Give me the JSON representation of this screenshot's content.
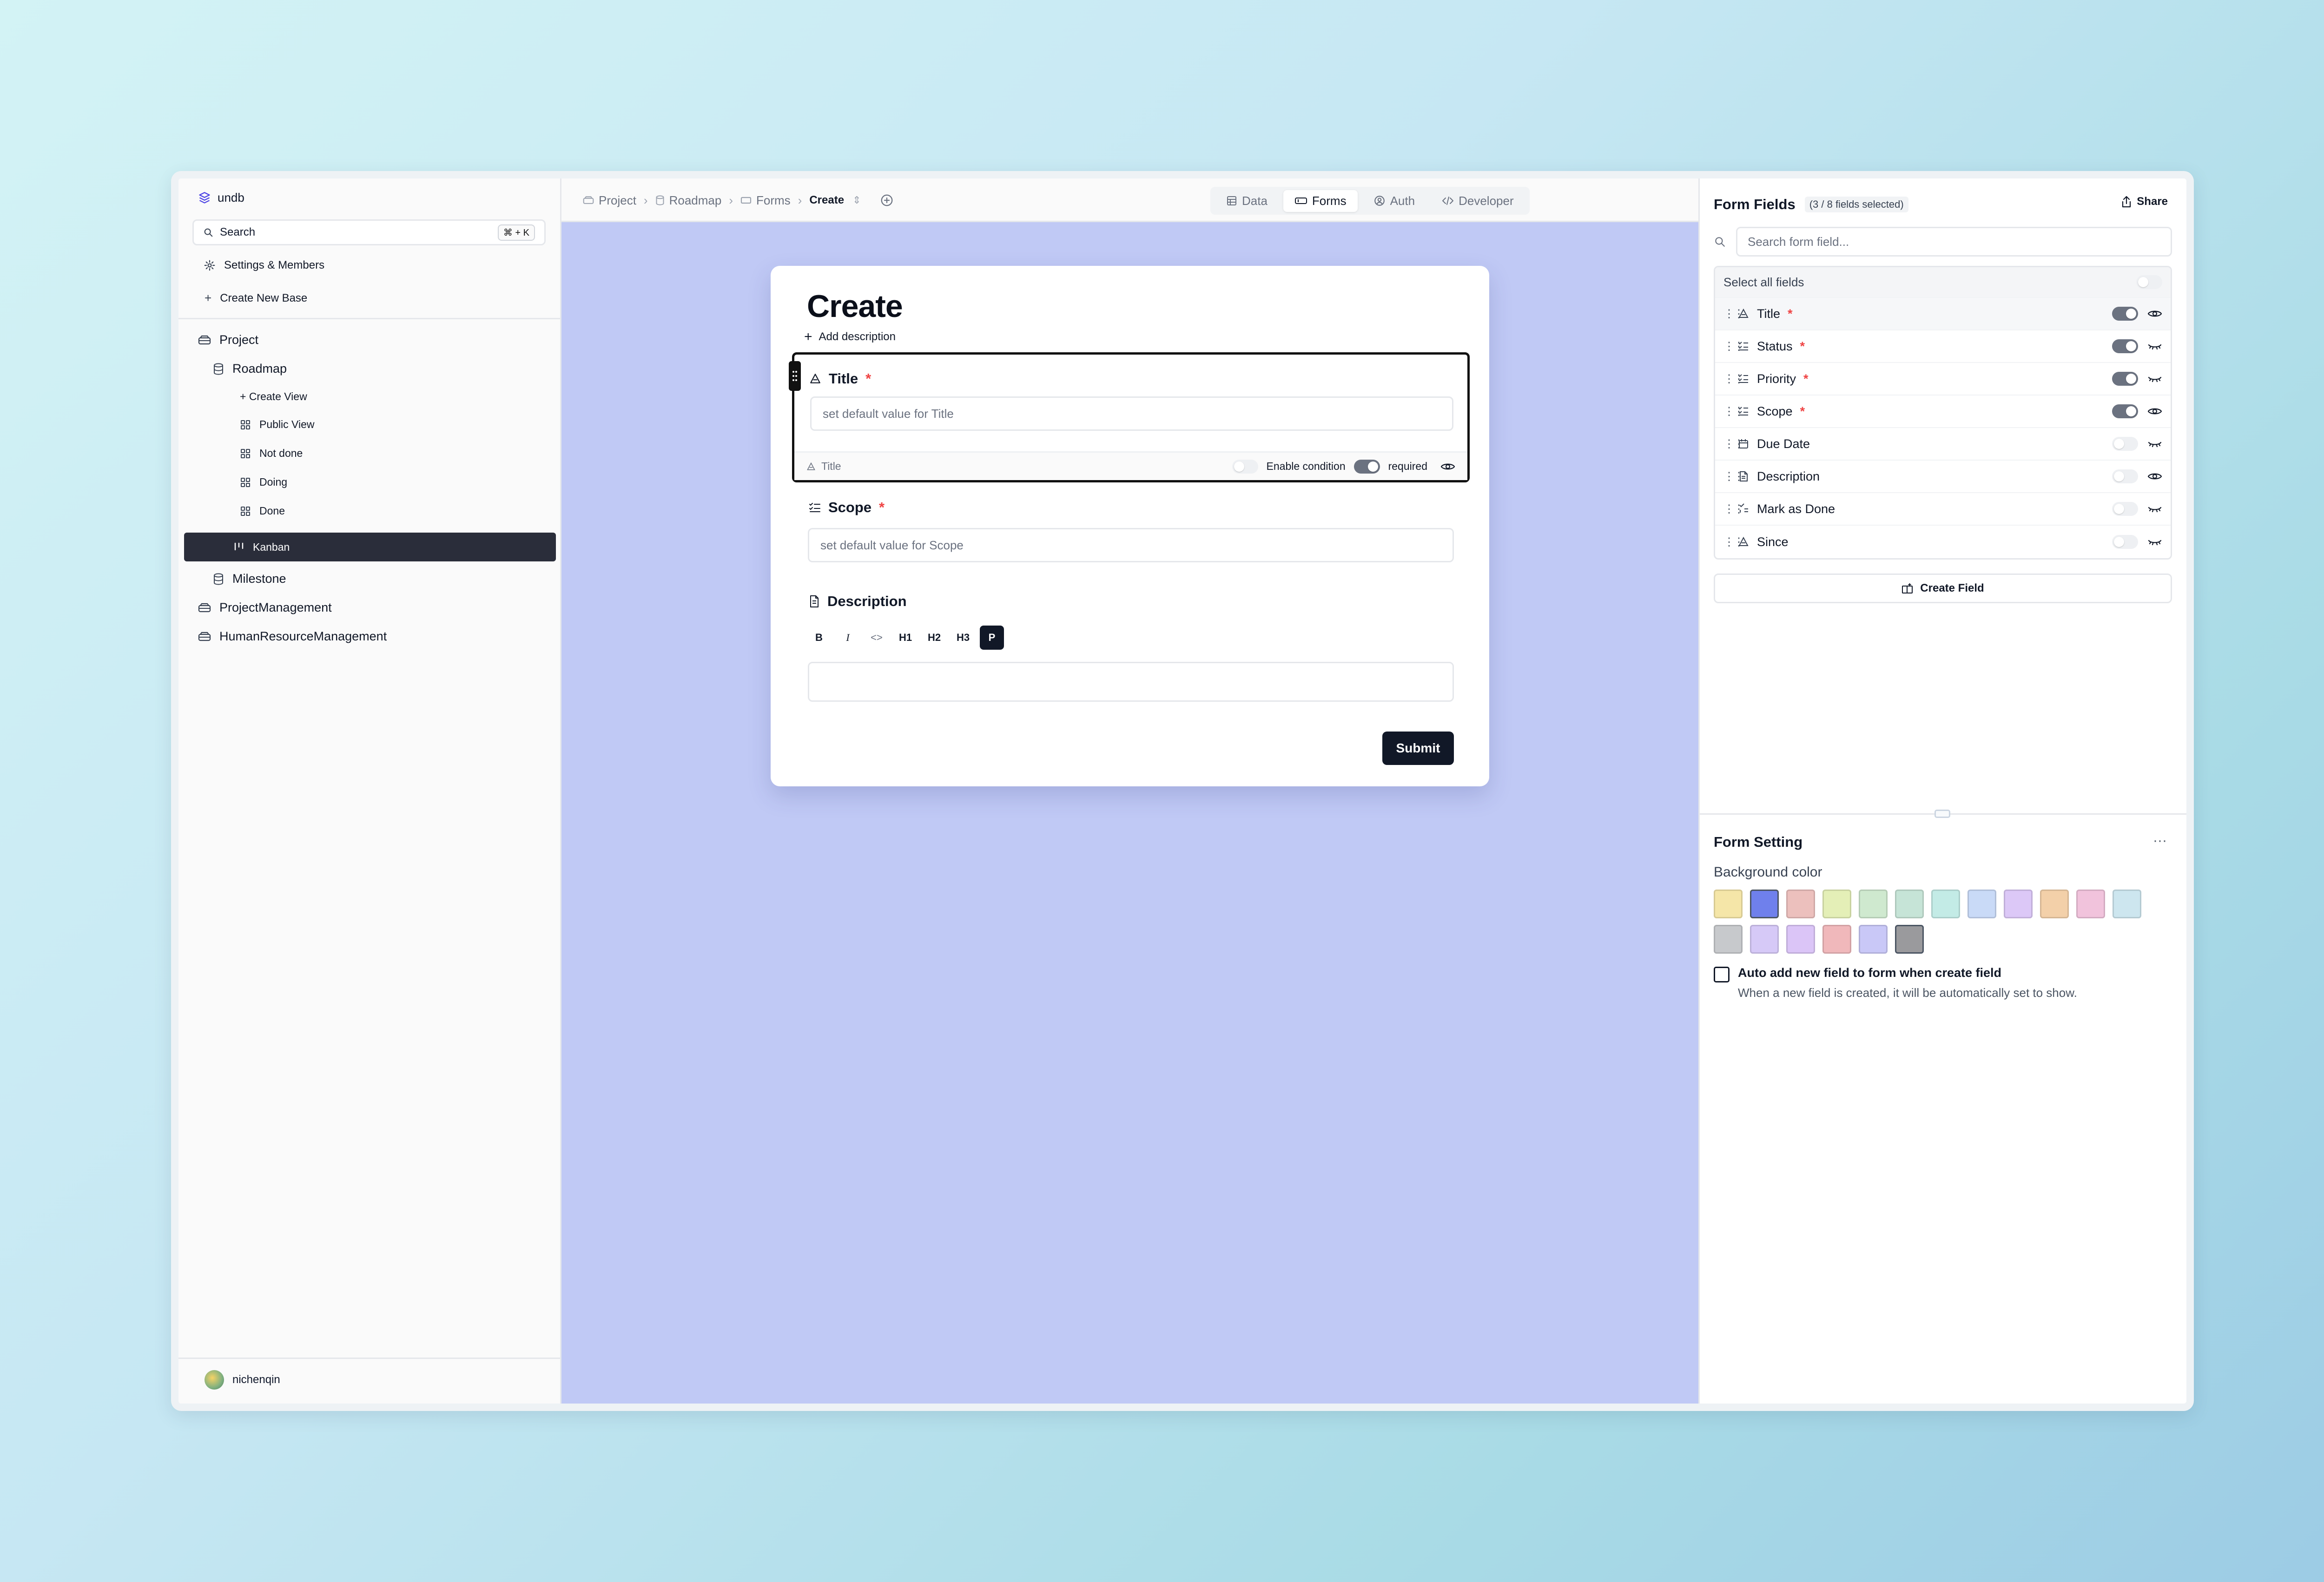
{
  "sidebar": {
    "brand": "undb",
    "search": {
      "label": "Search",
      "shortcut": "⌘ + K"
    },
    "settings": "Settings & Members",
    "create_base": "Create New Base",
    "bases": [
      {
        "label": "Project"
      },
      {
        "label": "ProjectManagement"
      },
      {
        "label": "HumanResourceManagement"
      }
    ],
    "tables": {
      "roadmap": "Roadmap",
      "milestone": "Milestone"
    },
    "views": {
      "create_view": "+ Create View",
      "items": [
        "Public View",
        "Not done",
        "Doing",
        "Done",
        "Kanban"
      ],
      "active": "Kanban"
    },
    "user": "nichenqin"
  },
  "topbar": {
    "breadcrumbs": [
      "Project",
      "Roadmap",
      "Forms",
      "Create"
    ],
    "tabs": [
      "Data",
      "Forms",
      "Auth",
      "Developer"
    ],
    "active_tab": "Forms"
  },
  "form": {
    "title": "Create",
    "add_description": "Add description",
    "fields": [
      {
        "label": "Title",
        "required": "*",
        "placeholder": "set default value for Title",
        "footer": {
          "field_name": "Title",
          "condition": "Enable condition",
          "required_label": "required",
          "condition_enabled": false,
          "required_enabled": true
        }
      },
      {
        "label": "Scope",
        "required": "*",
        "placeholder": "set default value for Scope"
      },
      {
        "label": "Description"
      }
    ],
    "editor_toolbar": [
      "B",
      "I",
      "<>",
      "H1",
      "H2",
      "H3",
      "P"
    ],
    "editor_active": "P",
    "submit": "Submit"
  },
  "form_fields_panel": {
    "title": "Form Fields",
    "subtitle": "(3 / 8 fields selected)",
    "share": "Share",
    "search_placeholder": "Search form field...",
    "select_all": "Select all fields",
    "fields": [
      {
        "name": "Title",
        "required": "*",
        "shown": true,
        "visible_icon": "eye-icon"
      },
      {
        "name": "Status",
        "required": "*",
        "shown": true,
        "visible_icon": "eye-closed-icon"
      },
      {
        "name": "Priority",
        "required": "*",
        "shown": true,
        "visible_icon": "eye-closed-icon"
      },
      {
        "name": "Scope",
        "required": "*",
        "shown": true,
        "visible_icon": "eye-icon"
      },
      {
        "name": "Due Date",
        "required": "",
        "shown": false,
        "visible_icon": "eye-closed-icon"
      },
      {
        "name": "Description",
        "required": "",
        "shown": false,
        "visible_icon": "eye-icon"
      },
      {
        "name": "Mark as Done",
        "required": "",
        "shown": false,
        "visible_icon": "eye-closed-icon"
      },
      {
        "name": "Since",
        "required": "",
        "shown": false,
        "visible_icon": "eye-closed-icon"
      }
    ],
    "create_field": "Create Field"
  },
  "form_setting": {
    "title": "Form Setting",
    "more": "···",
    "background_label": "Background color",
    "colors": [
      "#f5e6a8",
      "#6f80ec",
      "#ecc0bd",
      "#e4efb7",
      "#cfe9cf",
      "#c6e4d7",
      "#c3ebe6",
      "#c9daf7",
      "#dcc8f7",
      "#f3d0a9",
      "#f1c3dc",
      "#cde6ef",
      "#c7c9cc",
      "#d6c9f7",
      "#dbc5f7",
      "#f0b8bb",
      "#c9c8f7",
      "#9a9a9d"
    ],
    "selected_color": "#6f80ec",
    "auto_add_label": "Auto add new field to form when create field",
    "auto_add_help": "When a new field is created, it will be automatically set to show.",
    "auto_add_checked": false
  }
}
